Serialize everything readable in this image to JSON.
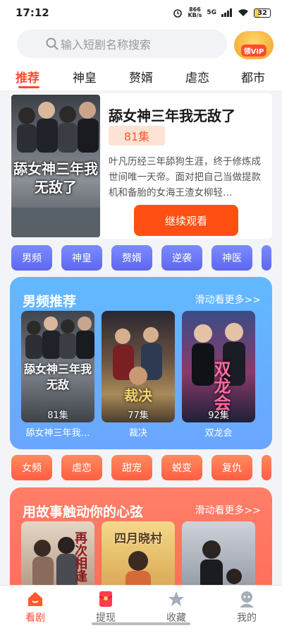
{
  "status_bar": {
    "time": "17:12",
    "speed_top": "866",
    "speed_bottom": "KB/s",
    "network": "5G",
    "battery": "32"
  },
  "search": {
    "placeholder": "输入短剧名称搜索",
    "vip_label": "领VIP"
  },
  "tabs": [
    {
      "label": "推荐",
      "active": true
    },
    {
      "label": "神皇"
    },
    {
      "label": "赘婿"
    },
    {
      "label": "虐恋"
    },
    {
      "label": "都市"
    }
  ],
  "hero": {
    "title": "舔女神三年我无敌了",
    "episodes": "81集",
    "description": "叶凡历经三年舔狗生涯，终于修炼成世间唯一天帝。面对把自己当做提款机和备胎的女海王渣女柳轻…",
    "poster_title": "舔女神三年我无敌了",
    "button_label": "继续观看"
  },
  "chips_row_1": [
    "男频",
    "神皇",
    "赘婿",
    "逆袭",
    "神医"
  ],
  "section_male": {
    "title": "男频推荐",
    "more": "滑动看更多>>",
    "items": [
      {
        "poster_title": "舔女神三年我无敌",
        "episodes": "81集",
        "title": "舔女神三年我…"
      },
      {
        "poster_title": "裁决",
        "episodes": "77集",
        "title": "裁决"
      },
      {
        "poster_title": "双龙会",
        "episodes": "92集",
        "title": "双龙会"
      }
    ]
  },
  "chips_row_2": [
    "女频",
    "虐恋",
    "甜宠",
    "蜕变",
    "复仇"
  ],
  "section_story": {
    "title": "用故事触动你的心弦",
    "more": "滑动看更多>>",
    "items": [
      {
        "poster_title": "再次相逢"
      },
      {
        "poster_title": "四月晓村"
      },
      {
        "poster_title": ""
      }
    ]
  },
  "bottom_nav": [
    {
      "label": "看剧",
      "icon": "home-icon",
      "active": true
    },
    {
      "label": "提现",
      "icon": "red-envelope-icon"
    },
    {
      "label": "收藏",
      "icon": "star-icon"
    },
    {
      "label": "我的",
      "icon": "profile-icon"
    }
  ],
  "colors": {
    "accent": "#ff4b2f",
    "continue_button": "#ff4f12",
    "chip_blue": "#6a74f6",
    "chip_red": "#ff6b4c",
    "section_blue": "#65b2ff",
    "section_red": "#ff7460"
  }
}
